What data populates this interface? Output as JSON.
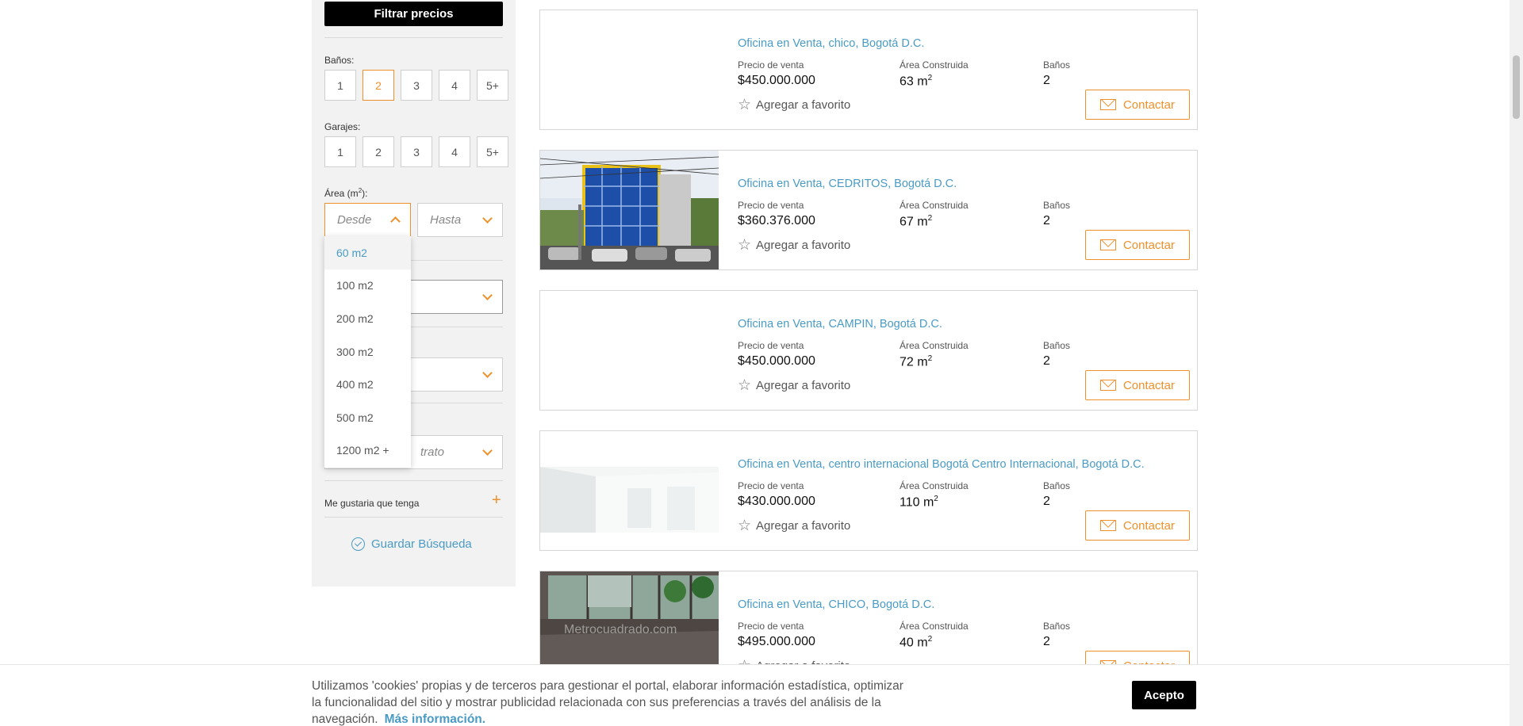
{
  "sidebar": {
    "filter_button": "Filtrar precios",
    "banos_label": "Baños:",
    "banos_options": [
      "1",
      "2",
      "3",
      "4",
      "5+"
    ],
    "banos_selected": "2",
    "garajes_label": "Garajes:",
    "garajes_options": [
      "1",
      "2",
      "3",
      "4",
      "5+"
    ],
    "area_label": "Área (m",
    "area_label_sup": "2",
    "area_label_end": "):",
    "area_from_placeholder": "Desde",
    "area_to_placeholder": "Hasta",
    "area_dropdown": [
      "60 m2",
      "100 m2",
      "200 m2",
      "300 m2",
      "400 m2",
      "500 m2",
      "1200 m2 +"
    ],
    "contract_placeholder_partial": "trato",
    "me_gustaria": "Me gustaria que tenga",
    "plus": "+",
    "guardar": "Guardar Búsqueda"
  },
  "listings": [
    {
      "title": "Oficina en Venta, chico, Bogotá D.C.",
      "price_label": "Precio de venta",
      "price": "$450.000.000",
      "area_label": "Área Construida",
      "area": "63 m",
      "banos_label": "Baños",
      "banos": "2",
      "fav": "Agregar a favorito",
      "contact": "Contactar",
      "photo": "none"
    },
    {
      "title": "Oficina en Venta, CEDRITOS, Bogotá D.C.",
      "price_label": "Precio de venta",
      "price": "$360.376.000",
      "area_label": "Área Construida",
      "area": "67 m",
      "banos_label": "Baños",
      "banos": "2",
      "fav": "Agregar a favorito",
      "contact": "Contactar",
      "photo": "building"
    },
    {
      "title": "Oficina en Venta, CAMPIN, Bogotá D.C.",
      "price_label": "Precio de venta",
      "price": "$450.000.000",
      "area_label": "Área Construida",
      "area": "72 m",
      "banos_label": "Baños",
      "banos": "2",
      "fav": "Agregar a favorito",
      "contact": "Contactar",
      "photo": "none"
    },
    {
      "title": "Oficina en Venta, centro internacional Bogotá Centro Internacional, Bogotá D.C.",
      "price_label": "Precio de venta",
      "price": "$430.000.000",
      "area_label": "Área Construida",
      "area": "110 m",
      "banos_label": "Baños",
      "banos": "2",
      "fav": "Agregar a favorito",
      "contact": "Contactar",
      "photo": "white-office"
    },
    {
      "title": "Oficina en Venta, CHICO, Bogotá D.C.",
      "price_label": "Precio de venta",
      "price": "$495.000.000",
      "area_label": "Área Construida",
      "area": "40 m",
      "banos_label": "Baños",
      "banos": "2",
      "fav": "Agregar a favorito",
      "contact": "Contactar",
      "photo": "glass-office",
      "watermark": "Metrocuadrado.com"
    }
  ],
  "area_sup": "2",
  "cookie": {
    "text": "Utilizamos 'cookies' propias y de terceros para gestionar el portal, elaborar información estadística, optimizar la funcionalidad del sitio y mostrar publicidad relacionada con sus preferencias a través del análisis de la navegación.",
    "link": "Más información.",
    "accept": "Acepto"
  },
  "colors": {
    "accent": "#f0902a",
    "link": "#4a9bc4",
    "dark": "#000000"
  }
}
